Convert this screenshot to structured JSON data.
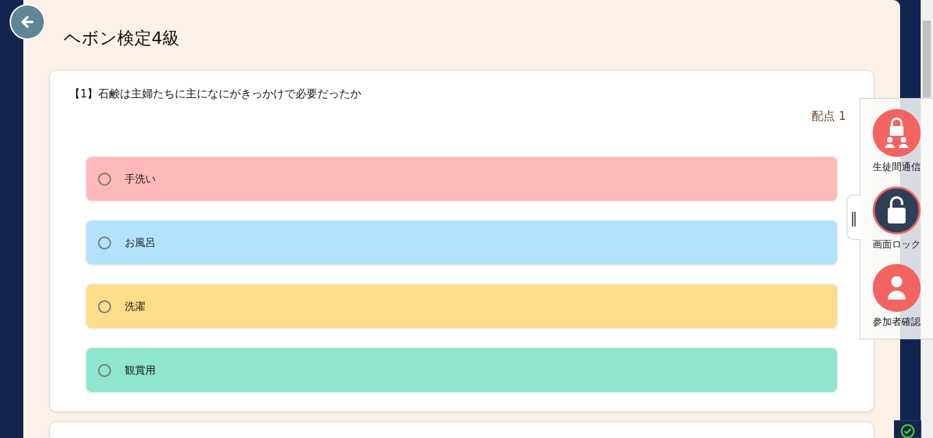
{
  "title": "ヘボン検定4級",
  "question": {
    "text": "【1】石鹸は主婦たちに主になにがきっかけで必要だったか",
    "score_label": "配点",
    "score": "1",
    "options": [
      {
        "label": "手洗い",
        "color": "#ffb9b9",
        "selected": false
      },
      {
        "label": "お風呂",
        "color": "#b3e2fc",
        "selected": false
      },
      {
        "label": "洗濯",
        "color": "#fddc8a",
        "selected": false
      },
      {
        "label": "観賞用",
        "color": "#8fe5cd",
        "selected": false
      }
    ]
  },
  "side_panel": {
    "handle": "‖",
    "buttons": [
      {
        "kind": "student-lock",
        "label": "生徒間通信",
        "on": false
      },
      {
        "kind": "screen-lock",
        "label": "画面ロック",
        "on": true
      },
      {
        "kind": "participants",
        "label": "参加者確認",
        "on": false
      }
    ]
  }
}
